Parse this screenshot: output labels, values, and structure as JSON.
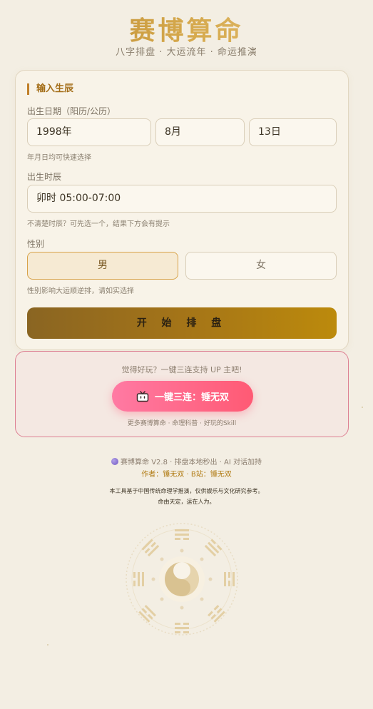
{
  "header": {
    "title": "赛博算命",
    "subtitle": "八字排盘 · 大运流年 · 命运推演"
  },
  "form": {
    "section_title": "输入生辰",
    "birth_date": {
      "label": "出生日期（阳历/公历）",
      "year": "1998年",
      "month": "8月",
      "day": "13日",
      "hint": "年月日均可快速选择"
    },
    "birth_time": {
      "label": "出生时辰",
      "value": "卯时 05:00-07:00",
      "hint": "不清楚时辰？可先选一个，结果下方会有提示"
    },
    "gender": {
      "label": "性别",
      "male": "男",
      "female": "女",
      "selected": "男",
      "hint": "性别影响大运顺逆排，请如实选择"
    },
    "submit_label": "开 始 排 盘"
  },
  "support": {
    "prompt": "觉得好玩？一键三连支持 UP 主吧!",
    "button_label": "一键三连：锤无双",
    "button_icon": "tv-icon",
    "more": "更多赛博算命 · 命理科普 · 好玩的Skill"
  },
  "footer": {
    "version_line": "赛博算命 V2.8 · 排盘本地秒出 · AI 对话加持",
    "version_icon": "crystal-ball-icon",
    "author_line": "作者：锤无双 · B站：锤无双",
    "disclaimer_1": "本工具基于中国传统命理学推演，仅供娱乐与文化研究参考。",
    "disclaimer_2": "命由天定，运在人为。"
  },
  "colors": {
    "background": "#f3eee3",
    "accent_gold": "#b8862a",
    "support_border": "#dd7f92",
    "support_button": "#ff5a74"
  }
}
